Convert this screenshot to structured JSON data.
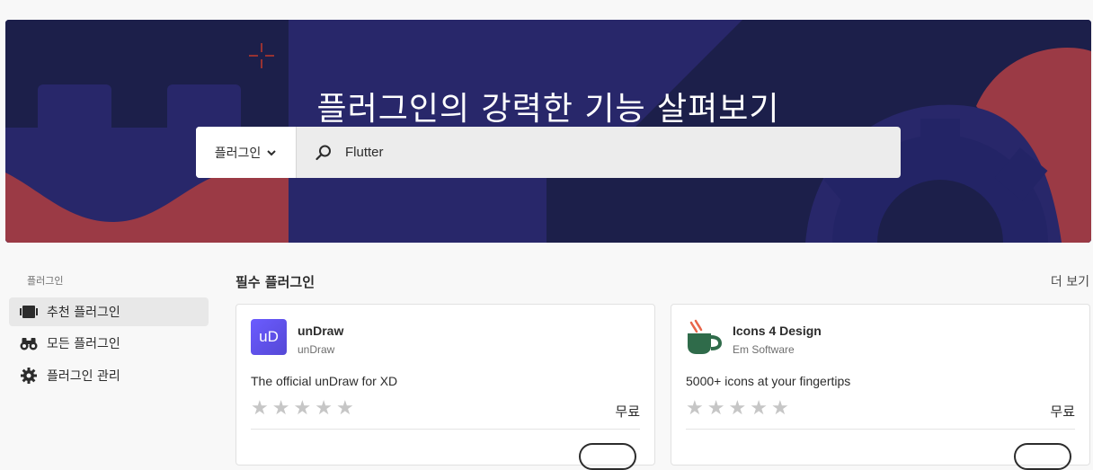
{
  "hero": {
    "title": "플러그인의 강력한 기능 살펴보기",
    "search": {
      "category_label": "플러그인",
      "query_value": "Flutter"
    }
  },
  "sidebar": {
    "heading": "플러그인",
    "items": [
      {
        "label": "추천 플러그인",
        "icon": "featured-icon",
        "active": true
      },
      {
        "label": "모든 플러그인",
        "icon": "binoculars-icon",
        "active": false
      },
      {
        "label": "플러그인 관리",
        "icon": "gear-icon",
        "active": false
      }
    ]
  },
  "main": {
    "section_title": "필수 플러그인",
    "see_more": "더 보기",
    "cards": [
      {
        "logo_text": "uD",
        "name": "unDraw",
        "vendor": "unDraw",
        "description": "The official unDraw for XD",
        "price": "무료",
        "rating_stars": 5,
        "logo_color": "#5c5ce6"
      },
      {
        "logo_text": "",
        "name": "Icons 4 Design",
        "vendor": "Em Software",
        "description": "5000+ icons at your fingertips",
        "price": "무료",
        "rating_stars": 5,
        "logo_color": "#2f6b4a"
      }
    ]
  },
  "colors": {
    "hero_navy": "#28276a",
    "hero_dark": "#1c1f4a",
    "hero_red": "#9b3a45",
    "star_empty": "#c6c6c6"
  }
}
